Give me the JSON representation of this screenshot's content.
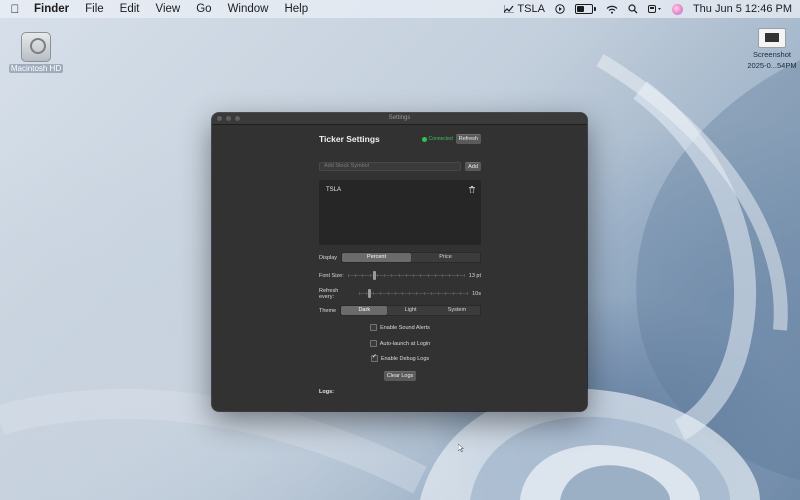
{
  "menubar": {
    "app_name": "Finder",
    "menus": [
      "File",
      "Edit",
      "View",
      "Go",
      "Window",
      "Help"
    ],
    "ticker_status_label": "TSLA",
    "clock": "Thu Jun 5  12:46 PM",
    "icons": [
      "apple-icon",
      "stock-chart-icon",
      "play-icon",
      "battery-icon",
      "wifi-icon",
      "search-icon",
      "control-center-icon",
      "siri-icon"
    ]
  },
  "desktop": {
    "drive_label": "Macintosh HD",
    "screenshot_label_line1": "Screenshot",
    "screenshot_label_line2": "2025-0...54PM"
  },
  "window": {
    "title": "Settings",
    "heading": "Ticker Settings",
    "status_text": "Connected",
    "status_color": "#2fc454",
    "refresh_label": "Refresh",
    "symbol_placeholder": "Add Stock Symbol",
    "add_label": "Add",
    "symbols": [
      "TSLA"
    ],
    "display": {
      "label": "Display",
      "options": [
        "Percent",
        "Price"
      ],
      "selected": "Percent"
    },
    "font_size": {
      "label": "Font Size:",
      "value_text": "13 pt",
      "position_fraction": 0.22
    },
    "refresh_every": {
      "label": "Refresh every:",
      "value_text": "10s",
      "position_fraction": 0.08
    },
    "theme": {
      "label": "Theme",
      "options": [
        "Dark",
        "Light",
        "System"
      ],
      "selected": "Dark"
    },
    "toggles": [
      {
        "label": "Enable Sound Alerts",
        "checked": false
      },
      {
        "label": "Auto-launch at Login",
        "checked": false
      },
      {
        "label": "Enable Debug Logs",
        "checked": true
      }
    ],
    "clear_logs_label": "Clear Logs",
    "logs_label": "Logs:"
  }
}
